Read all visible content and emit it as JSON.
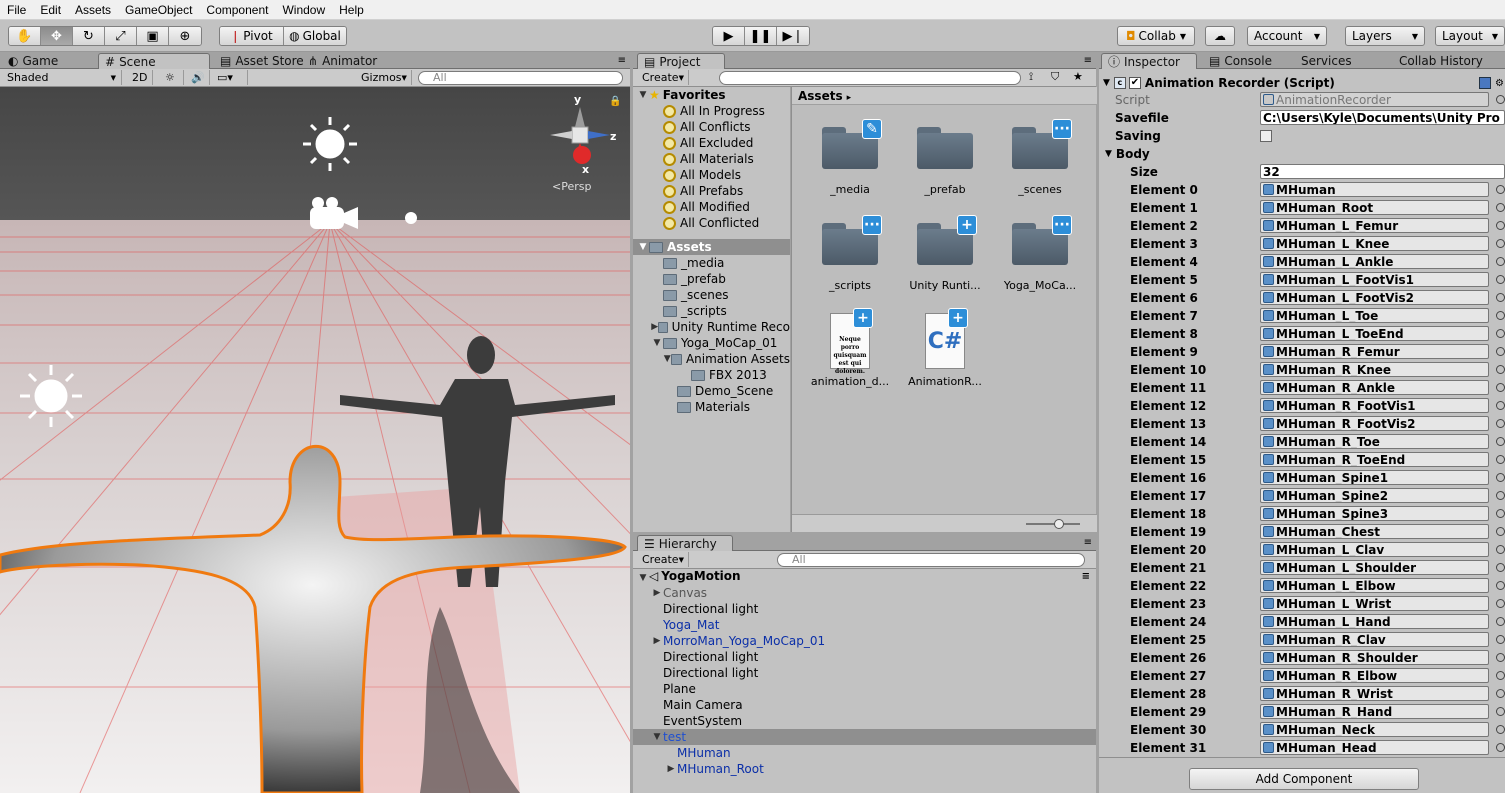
{
  "menu": [
    "File",
    "Edit",
    "Assets",
    "GameObject",
    "Component",
    "Window",
    "Help"
  ],
  "toolbar": {
    "pivot": "Pivot",
    "global": "Global",
    "collab": "Collab",
    "account": "Account",
    "layers": "Layers",
    "layout": "Layout"
  },
  "scene": {
    "tabs": [
      "Game",
      "Scene",
      "Asset Store",
      "Animator"
    ],
    "shaded": "Shaded",
    "two_d": "2D",
    "gizmos": "Gizmos",
    "search_placeholder": "All",
    "persp": "Persp",
    "axis_y": "y",
    "axis_z": "z",
    "axis_x": "x"
  },
  "project": {
    "tab": "Project",
    "create": "Create",
    "favorites_label": "Favorites",
    "favorites": [
      "All In Progress",
      "All Conflicts",
      "All Excluded",
      "All Materials",
      "All Models",
      "All Prefabs",
      "All Modified",
      "All Conflicted"
    ],
    "assets_label": "Assets",
    "assets_tree": [
      "_media",
      "_prefab",
      "_scenes",
      "_scripts",
      "Unity Runtime Reco",
      "Yoga_MoCap_01",
      "Animation Assets",
      "FBX 2013",
      "Demo_Scene",
      "Materials"
    ],
    "breadcrumb": "Assets",
    "grid": [
      "_media",
      "_prefab",
      "_scenes",
      "_scripts",
      "Unity Runti...",
      "Yoga_MoCa...",
      "animation_d...",
      "AnimationR..."
    ],
    "doc_text": "Neque porro quisquam est qui dolorem.",
    "cs_text": "C#"
  },
  "hierarchy": {
    "tab": "Hierarchy",
    "create": "Create",
    "search_placeholder": "All",
    "scene_name": "YogaMotion",
    "items": [
      "Canvas",
      "Directional light",
      "Yoga_Mat",
      "MorroMan_Yoga_MoCap_01",
      "Directional light",
      "Directional light",
      "Plane",
      "Main Camera",
      "EventSystem",
      "test",
      "MHuman",
      "MHuman_Root"
    ]
  },
  "inspector": {
    "tabs": [
      "Inspector",
      "Console",
      "Services",
      "Collab History"
    ],
    "component_title": "Animation Recorder (Script)",
    "script_label": "Script",
    "script_value": "AnimationRecorder",
    "savefile_label": "Savefile",
    "savefile_value": "C:\\Users\\Kyle\\Documents\\Unity Pro",
    "saving_label": "Saving",
    "body_label": "Body",
    "size_label": "Size",
    "size_value": "32",
    "elements": [
      {
        "label": "Element 0",
        "value": "MHuman"
      },
      {
        "label": "Element 1",
        "value": "MHuman_Root"
      },
      {
        "label": "Element 2",
        "value": "MHuman_L_Femur"
      },
      {
        "label": "Element 3",
        "value": "MHuman_L_Knee"
      },
      {
        "label": "Element 4",
        "value": "MHuman_L_Ankle"
      },
      {
        "label": "Element 5",
        "value": "MHuman_L_FootVis1"
      },
      {
        "label": "Element 6",
        "value": "MHuman_L_FootVis2"
      },
      {
        "label": "Element 7",
        "value": "MHuman_L_Toe"
      },
      {
        "label": "Element 8",
        "value": "MHuman_L_ToeEnd"
      },
      {
        "label": "Element 9",
        "value": "MHuman_R_Femur"
      },
      {
        "label": "Element 10",
        "value": "MHuman_R_Knee"
      },
      {
        "label": "Element 11",
        "value": "MHuman_R_Ankle"
      },
      {
        "label": "Element 12",
        "value": "MHuman_R_FootVis1"
      },
      {
        "label": "Element 13",
        "value": "MHuman_R_FootVis2"
      },
      {
        "label": "Element 14",
        "value": "MHuman_R_Toe"
      },
      {
        "label": "Element 15",
        "value": "MHuman_R_ToeEnd"
      },
      {
        "label": "Element 16",
        "value": "MHuman_Spine1"
      },
      {
        "label": "Element 17",
        "value": "MHuman_Spine2"
      },
      {
        "label": "Element 18",
        "value": "MHuman_Spine3"
      },
      {
        "label": "Element 19",
        "value": "MHuman_Chest"
      },
      {
        "label": "Element 20",
        "value": "MHuman_L_Clav"
      },
      {
        "label": "Element 21",
        "value": "MHuman_L_Shoulder"
      },
      {
        "label": "Element 22",
        "value": "MHuman_L_Elbow"
      },
      {
        "label": "Element 23",
        "value": "MHuman_L_Wrist"
      },
      {
        "label": "Element 24",
        "value": "MHuman_L_Hand"
      },
      {
        "label": "Element 25",
        "value": "MHuman_R_Clav"
      },
      {
        "label": "Element 26",
        "value": "MHuman_R_Shoulder"
      },
      {
        "label": "Element 27",
        "value": "MHuman_R_Elbow"
      },
      {
        "label": "Element 28",
        "value": "MHuman_R_Wrist"
      },
      {
        "label": "Element 29",
        "value": "MHuman_R_Hand"
      },
      {
        "label": "Element 30",
        "value": "MHuman_Neck"
      },
      {
        "label": "Element 31",
        "value": "MHuman_Head"
      }
    ],
    "add_component": "Add Component"
  }
}
